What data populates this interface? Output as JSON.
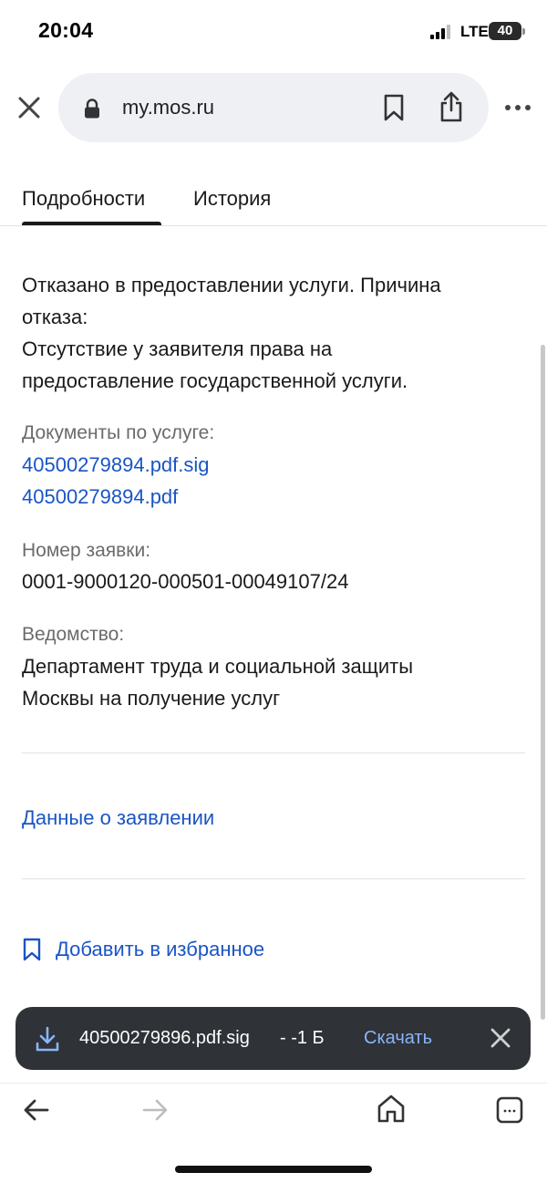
{
  "status_bar": {
    "time": "20:04",
    "network": "LTE",
    "battery": "40"
  },
  "browser": {
    "url": "my.mos.ru"
  },
  "tabs": [
    {
      "label": "Подробности",
      "active": true
    },
    {
      "label": "История",
      "active": false
    }
  ],
  "details": {
    "status_lines": [
      "Отказано в предоставлении услуги. Причина",
      "отказа:",
      "Отсутствие у заявителя права на",
      "предоставление государственной услуги."
    ],
    "documents_label": "Документы по услуге:",
    "documents": [
      "40500279894.pdf.sig",
      "40500279894.pdf"
    ],
    "request_number_label": "Номер заявки:",
    "request_number": "0001-9000120-000501-00049107/24",
    "department_label": "Ведомство:",
    "department_lines": [
      "Департамент труда и социальной защиты",
      "Москвы на получение услуг"
    ],
    "application_data_link": "Данные о заявлении",
    "add_favorite_link": "Добавить в избранное"
  },
  "download_bar": {
    "filename": "40500279896.pdf.sig",
    "size": "- -1 Б",
    "action": "Скачать"
  },
  "colors": {
    "link": "#1a55c4",
    "download_bar_bg": "#2f3237",
    "download_action": "#8ab4f8",
    "url_bar_bg": "#eef0f4"
  },
  "icons": [
    "close-icon",
    "lock-icon",
    "bookmark-icon",
    "share-icon",
    "more-icon",
    "download-icon",
    "back-arrow-icon",
    "forward-arrow-icon",
    "home-icon",
    "tabs-icon"
  ]
}
